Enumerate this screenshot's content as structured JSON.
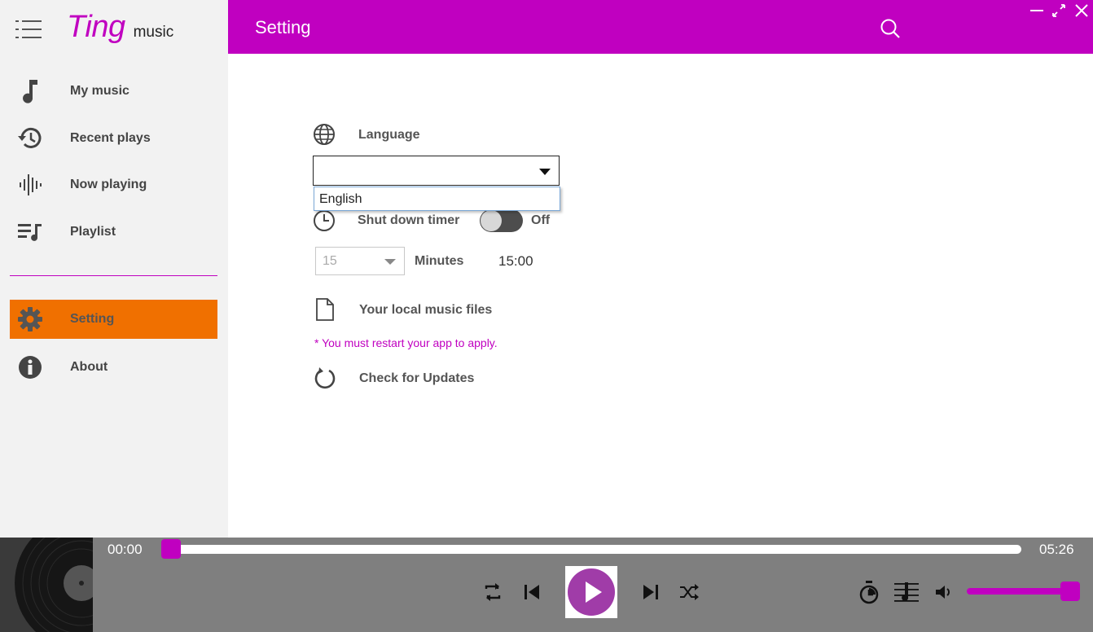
{
  "app": {
    "brand_name": "Ting",
    "brand_suffix": "music",
    "accent_color": "#c000c0",
    "active_color": "#f07000"
  },
  "sidebar": {
    "items": [
      {
        "label": "My music",
        "icon": "music-note-icon"
      },
      {
        "label": "Recent plays",
        "icon": "history-icon"
      },
      {
        "label": "Now playing",
        "icon": "waveform-icon"
      },
      {
        "label": "Playlist",
        "icon": "playlist-icon"
      },
      {
        "label": "Setting",
        "icon": "gear-icon",
        "active": true
      },
      {
        "label": "About",
        "icon": "info-icon"
      }
    ]
  },
  "header": {
    "title": "Setting"
  },
  "settings": {
    "language_label": "Language",
    "language_value": "",
    "language_options": [
      "English"
    ],
    "shutdown_label": "Shut down timer",
    "shutdown_state": "Off",
    "minutes_value": "15",
    "minutes_label": "Minutes",
    "time_value": "15:00",
    "local_files_label": "Your local music files",
    "restart_note": "* You must restart your app to apply.",
    "updates_label": "Check for Updates"
  },
  "player": {
    "current_time": "00:00",
    "total_time": "05:26",
    "progress_fraction": 0,
    "volume_fraction": 1
  }
}
